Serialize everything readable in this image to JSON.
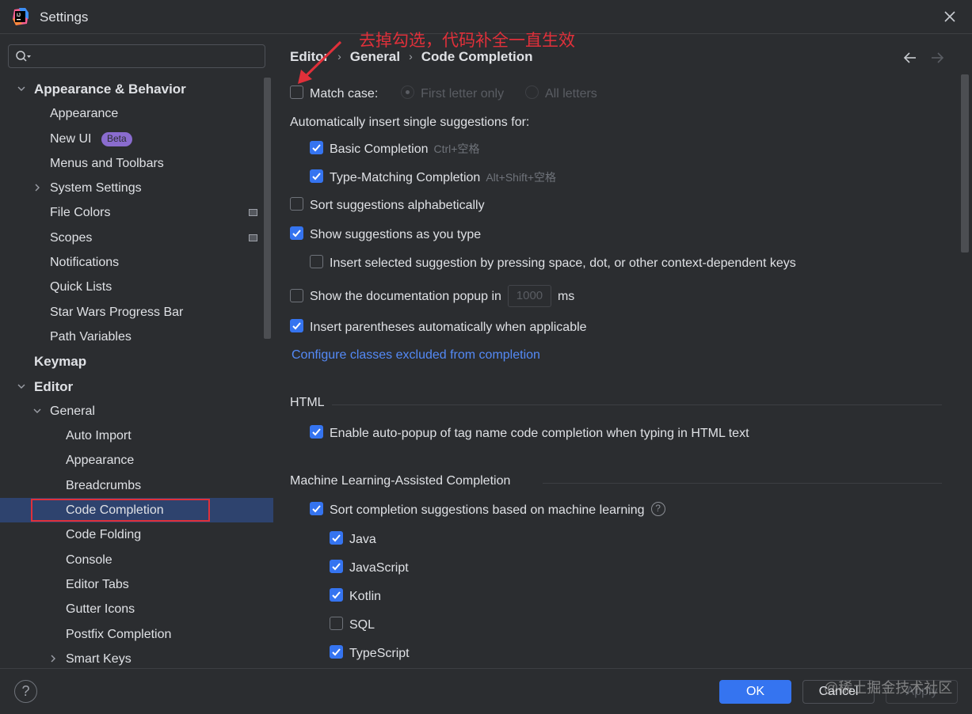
{
  "window": {
    "title": "Settings",
    "close_icon": "close-icon",
    "app_icon": "intellij-idea-logo"
  },
  "search": {
    "placeholder": "",
    "value": ""
  },
  "sidebar": {
    "items": [
      {
        "label": "Appearance & Behavior",
        "level": 0,
        "expanded": true,
        "bold": true
      },
      {
        "label": "Appearance",
        "level": 1
      },
      {
        "label": "New UI",
        "level": 1,
        "badge": "Beta"
      },
      {
        "label": "Menus and Toolbars",
        "level": 1
      },
      {
        "label": "System Settings",
        "level": 1,
        "collapsed": true
      },
      {
        "label": "File Colors",
        "level": 1,
        "project_icon": true
      },
      {
        "label": "Scopes",
        "level": 1,
        "project_icon": true
      },
      {
        "label": "Notifications",
        "level": 1
      },
      {
        "label": "Quick Lists",
        "level": 1
      },
      {
        "label": "Star Wars Progress Bar",
        "level": 1
      },
      {
        "label": "Path Variables",
        "level": 1
      },
      {
        "label": "Keymap",
        "level": 0,
        "bold": true
      },
      {
        "label": "Editor",
        "level": 0,
        "expanded": true,
        "bold": true
      },
      {
        "label": "General",
        "level": 1,
        "expanded": true
      },
      {
        "label": "Auto Import",
        "level": 2
      },
      {
        "label": "Appearance",
        "level": 2
      },
      {
        "label": "Breadcrumbs",
        "level": 2
      },
      {
        "label": "Code Completion",
        "level": 2,
        "selected": true
      },
      {
        "label": "Code Folding",
        "level": 2
      },
      {
        "label": "Console",
        "level": 2
      },
      {
        "label": "Editor Tabs",
        "level": 2
      },
      {
        "label": "Gutter Icons",
        "level": 2
      },
      {
        "label": "Postfix Completion",
        "level": 2
      },
      {
        "label": "Smart Keys",
        "level": 2,
        "collapsed": true
      }
    ]
  },
  "breadcrumb": [
    "Editor",
    "General",
    "Code Completion"
  ],
  "annotation": "去掉勾选，代码补全一直生效",
  "settings": {
    "match_case": {
      "label": "Match case:",
      "checked": false
    },
    "match_case_options": [
      {
        "label": "First letter only",
        "selected": true
      },
      {
        "label": "All letters",
        "selected": false
      }
    ],
    "auto_insert_heading": "Automatically insert single suggestions for:",
    "basic_completion": {
      "label": "Basic Completion",
      "shortcut": "Ctrl+空格",
      "checked": true
    },
    "type_matching": {
      "label": "Type-Matching Completion",
      "shortcut": "Alt+Shift+空格",
      "checked": true
    },
    "sort_alpha": {
      "label": "Sort suggestions alphabetically",
      "checked": false
    },
    "show_as_type": {
      "label": "Show suggestions as you type",
      "checked": true
    },
    "insert_selected": {
      "label": "Insert selected suggestion by pressing space, dot, or other context-dependent keys",
      "checked": false
    },
    "doc_popup": {
      "label": "Show the documentation popup in",
      "value": "1000",
      "unit": "ms",
      "checked": false
    },
    "parentheses": {
      "label": "Insert parentheses automatically when applicable",
      "checked": true
    },
    "configure_link": "Configure classes excluded from completion",
    "html_section": "HTML",
    "html_autopopup": {
      "label": "Enable auto-popup of tag name code completion when typing in HTML text",
      "checked": true
    },
    "ml_section": "Machine Learning-Assisted Completion",
    "ml_sort": {
      "label": "Sort completion suggestions based on machine learning",
      "checked": true,
      "help": "?"
    },
    "ml_languages": [
      {
        "label": "Java",
        "checked": true
      },
      {
        "label": "JavaScript",
        "checked": true
      },
      {
        "label": "Kotlin",
        "checked": true
      },
      {
        "label": "SQL",
        "checked": false
      },
      {
        "label": "TypeScript",
        "checked": true
      }
    ]
  },
  "footer": {
    "help": "?",
    "ok": "OK",
    "cancel": "Cancel",
    "apply": "Apply",
    "watermark": "@稀土掘金技术社区"
  },
  "colors": {
    "accent": "#3574f0",
    "selection": "#2e436e",
    "annotation": "#e0303a",
    "link": "#548af7",
    "badge": "#8a6ccf"
  }
}
